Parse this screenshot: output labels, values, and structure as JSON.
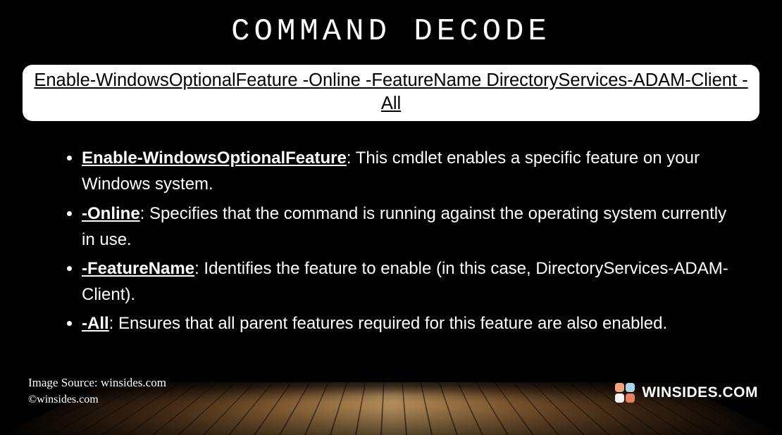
{
  "title": "COMMAND DECODE",
  "command": "Enable-WindowsOptionalFeature -Online -FeatureName DirectoryServices-ADAM-Client -All",
  "items": [
    {
      "term": "Enable-WindowsOptionalFeature",
      "desc": ": This cmdlet enables a specific feature on your Windows system."
    },
    {
      "term": "-Online",
      "desc": ": Specifies that the command is running against the operating system currently in use."
    },
    {
      "term": "-FeatureName",
      "desc": ": Identifies the feature to enable (in this case, DirectoryServices-ADAM-Client)."
    },
    {
      "term": "-All",
      "desc": ": Ensures that all parent features required for this feature are also enabled."
    }
  ],
  "footer": {
    "source": "Image Source: winsides.com",
    "copyright": "©winsides.com"
  },
  "brand": "WINSIDES.COM"
}
